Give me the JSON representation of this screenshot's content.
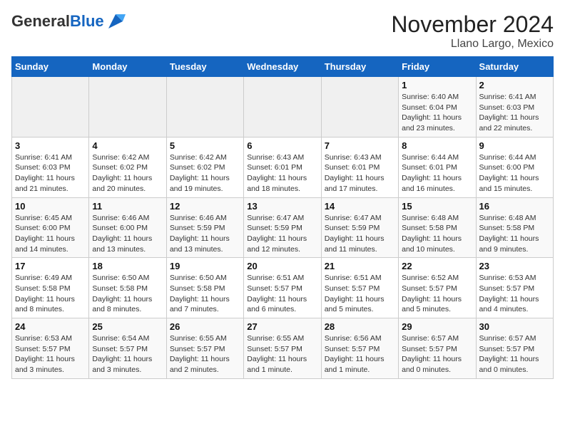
{
  "header": {
    "logo_general": "General",
    "logo_blue": "Blue",
    "month_title": "November 2024",
    "location": "Llano Largo, Mexico"
  },
  "weekdays": [
    "Sunday",
    "Monday",
    "Tuesday",
    "Wednesday",
    "Thursday",
    "Friday",
    "Saturday"
  ],
  "weeks": [
    [
      {
        "day": "",
        "info": ""
      },
      {
        "day": "",
        "info": ""
      },
      {
        "day": "",
        "info": ""
      },
      {
        "day": "",
        "info": ""
      },
      {
        "day": "",
        "info": ""
      },
      {
        "day": "1",
        "info": "Sunrise: 6:40 AM\nSunset: 6:04 PM\nDaylight: 11 hours and 23 minutes."
      },
      {
        "day": "2",
        "info": "Sunrise: 6:41 AM\nSunset: 6:03 PM\nDaylight: 11 hours and 22 minutes."
      }
    ],
    [
      {
        "day": "3",
        "info": "Sunrise: 6:41 AM\nSunset: 6:03 PM\nDaylight: 11 hours and 21 minutes."
      },
      {
        "day": "4",
        "info": "Sunrise: 6:42 AM\nSunset: 6:02 PM\nDaylight: 11 hours and 20 minutes."
      },
      {
        "day": "5",
        "info": "Sunrise: 6:42 AM\nSunset: 6:02 PM\nDaylight: 11 hours and 19 minutes."
      },
      {
        "day": "6",
        "info": "Sunrise: 6:43 AM\nSunset: 6:01 PM\nDaylight: 11 hours and 18 minutes."
      },
      {
        "day": "7",
        "info": "Sunrise: 6:43 AM\nSunset: 6:01 PM\nDaylight: 11 hours and 17 minutes."
      },
      {
        "day": "8",
        "info": "Sunrise: 6:44 AM\nSunset: 6:01 PM\nDaylight: 11 hours and 16 minutes."
      },
      {
        "day": "9",
        "info": "Sunrise: 6:44 AM\nSunset: 6:00 PM\nDaylight: 11 hours and 15 minutes."
      }
    ],
    [
      {
        "day": "10",
        "info": "Sunrise: 6:45 AM\nSunset: 6:00 PM\nDaylight: 11 hours and 14 minutes."
      },
      {
        "day": "11",
        "info": "Sunrise: 6:46 AM\nSunset: 6:00 PM\nDaylight: 11 hours and 13 minutes."
      },
      {
        "day": "12",
        "info": "Sunrise: 6:46 AM\nSunset: 5:59 PM\nDaylight: 11 hours and 13 minutes."
      },
      {
        "day": "13",
        "info": "Sunrise: 6:47 AM\nSunset: 5:59 PM\nDaylight: 11 hours and 12 minutes."
      },
      {
        "day": "14",
        "info": "Sunrise: 6:47 AM\nSunset: 5:59 PM\nDaylight: 11 hours and 11 minutes."
      },
      {
        "day": "15",
        "info": "Sunrise: 6:48 AM\nSunset: 5:58 PM\nDaylight: 11 hours and 10 minutes."
      },
      {
        "day": "16",
        "info": "Sunrise: 6:48 AM\nSunset: 5:58 PM\nDaylight: 11 hours and 9 minutes."
      }
    ],
    [
      {
        "day": "17",
        "info": "Sunrise: 6:49 AM\nSunset: 5:58 PM\nDaylight: 11 hours and 8 minutes."
      },
      {
        "day": "18",
        "info": "Sunrise: 6:50 AM\nSunset: 5:58 PM\nDaylight: 11 hours and 8 minutes."
      },
      {
        "day": "19",
        "info": "Sunrise: 6:50 AM\nSunset: 5:58 PM\nDaylight: 11 hours and 7 minutes."
      },
      {
        "day": "20",
        "info": "Sunrise: 6:51 AM\nSunset: 5:57 PM\nDaylight: 11 hours and 6 minutes."
      },
      {
        "day": "21",
        "info": "Sunrise: 6:51 AM\nSunset: 5:57 PM\nDaylight: 11 hours and 5 minutes."
      },
      {
        "day": "22",
        "info": "Sunrise: 6:52 AM\nSunset: 5:57 PM\nDaylight: 11 hours and 5 minutes."
      },
      {
        "day": "23",
        "info": "Sunrise: 6:53 AM\nSunset: 5:57 PM\nDaylight: 11 hours and 4 minutes."
      }
    ],
    [
      {
        "day": "24",
        "info": "Sunrise: 6:53 AM\nSunset: 5:57 PM\nDaylight: 11 hours and 3 minutes."
      },
      {
        "day": "25",
        "info": "Sunrise: 6:54 AM\nSunset: 5:57 PM\nDaylight: 11 hours and 3 minutes."
      },
      {
        "day": "26",
        "info": "Sunrise: 6:55 AM\nSunset: 5:57 PM\nDaylight: 11 hours and 2 minutes."
      },
      {
        "day": "27",
        "info": "Sunrise: 6:55 AM\nSunset: 5:57 PM\nDaylight: 11 hours and 1 minute."
      },
      {
        "day": "28",
        "info": "Sunrise: 6:56 AM\nSunset: 5:57 PM\nDaylight: 11 hours and 1 minute."
      },
      {
        "day": "29",
        "info": "Sunrise: 6:57 AM\nSunset: 5:57 PM\nDaylight: 11 hours and 0 minutes."
      },
      {
        "day": "30",
        "info": "Sunrise: 6:57 AM\nSunset: 5:57 PM\nDaylight: 11 hours and 0 minutes."
      }
    ]
  ]
}
